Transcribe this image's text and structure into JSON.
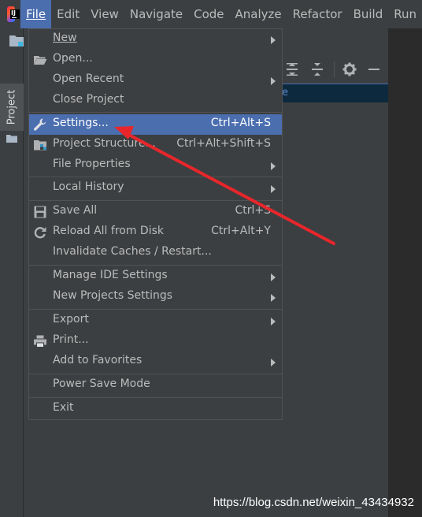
{
  "menubar": {
    "items": [
      {
        "label": "File",
        "active": true
      },
      {
        "label": "Edit"
      },
      {
        "label": "View"
      },
      {
        "label": "Navigate"
      },
      {
        "label": "Code"
      },
      {
        "label": "Analyze"
      },
      {
        "label": "Refactor"
      },
      {
        "label": "Build"
      },
      {
        "label": "Run"
      }
    ]
  },
  "app": {
    "logo": "intellij-idea-logo",
    "logo_text": "IJ"
  },
  "side_panel": {
    "tab_label": "Project"
  },
  "selection": {
    "char": "e"
  },
  "file_menu": {
    "items": [
      {
        "label": "New",
        "submenu": true
      },
      {
        "label": "Open...",
        "icon": "folder-open-icon"
      },
      {
        "label": "Open Recent",
        "submenu": true
      },
      {
        "label": "Close Project"
      },
      {
        "label": "Settings...",
        "shortcut": "Ctrl+Alt+S",
        "icon": "wrench-icon",
        "selected": true
      },
      {
        "label": "Project Structure...",
        "shortcut": "Ctrl+Alt+Shift+S",
        "icon": "project-structure-icon"
      },
      {
        "label": "File Properties",
        "submenu": true
      },
      {
        "label": "Local History",
        "submenu": true
      },
      {
        "label": "Save All",
        "shortcut": "Ctrl+S",
        "icon": "save-icon"
      },
      {
        "label": "Reload All from Disk",
        "shortcut": "Ctrl+Alt+Y",
        "icon": "reload-icon"
      },
      {
        "label": "Invalidate Caches / Restart..."
      },
      {
        "label": "Manage IDE Settings",
        "submenu": true
      },
      {
        "label": "New Projects Settings",
        "submenu": true
      },
      {
        "label": "Export",
        "submenu": true
      },
      {
        "label": "Print...",
        "icon": "print-icon"
      },
      {
        "label": "Add to Favorites",
        "submenu": true
      },
      {
        "label": "Power Save Mode"
      },
      {
        "label": "Exit"
      }
    ]
  },
  "annotation": {
    "arrow_color": "#e8262b"
  },
  "watermark": "https://blog.csdn.net/weixin_43434932",
  "colors": {
    "accent": "#4b6eaf",
    "background": "#3c3f41",
    "text": "#bbbbbb"
  }
}
